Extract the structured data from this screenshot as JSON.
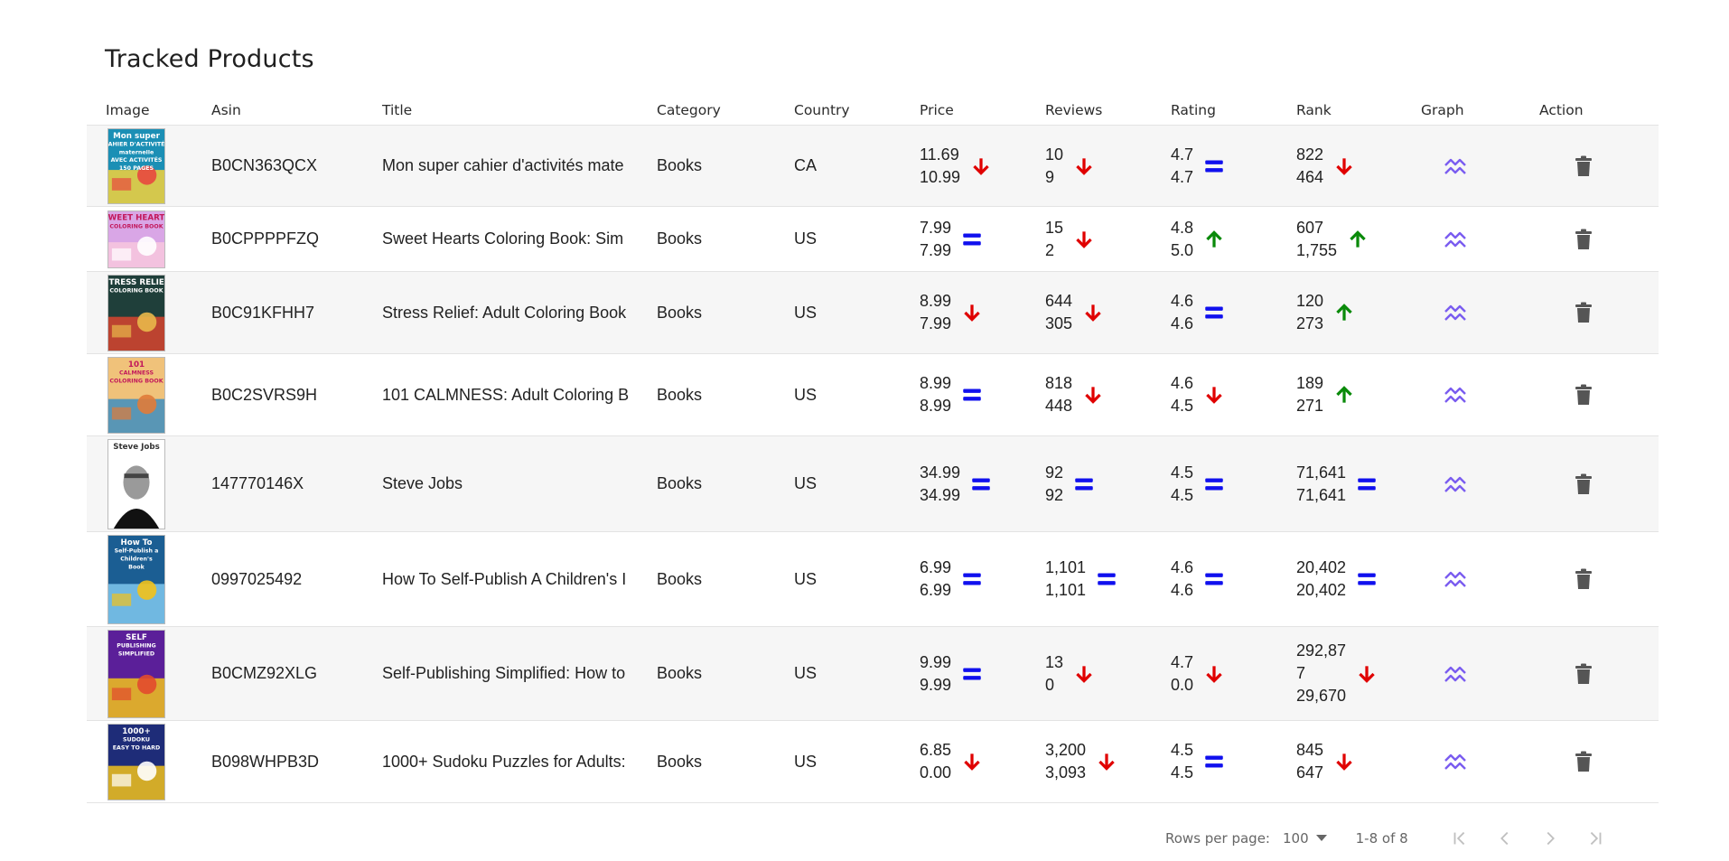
{
  "page": {
    "title": "Tracked Products"
  },
  "table": {
    "columns": [
      "Image",
      "Asin",
      "Title",
      "Category",
      "Country",
      "Price",
      "Reviews",
      "Rating",
      "Rank",
      "Graph",
      "Action"
    ],
    "rows": [
      {
        "asin": "B0CN363QCX",
        "title": "Mon super cahier d'activités mate",
        "category": "Books",
        "country": "CA",
        "price": [
          "11.69",
          "10.99"
        ],
        "price_trend": "down",
        "reviews": [
          "10",
          "9"
        ],
        "reviews_trend": "down",
        "rating": [
          "4.7",
          "4.7"
        ],
        "rating_trend": "equal",
        "rank": [
          "822",
          "464"
        ],
        "rank_trend": "down",
        "cover": {
          "colors": [
            "#1b8fb5",
            "#f4d23b",
            "#e8483f"
          ],
          "lines": [
            "Mon super",
            "CAHIER D'ACTIVITÉS",
            "maternelle",
            "AVEC ACTIVITÉS",
            "150 PAGES"
          ]
        }
      },
      {
        "asin": "B0CPPPPFZQ",
        "title": "Sweet Hearts Coloring Book: Sim",
        "category": "Books",
        "country": "US",
        "price": [
          "7.99",
          "7.99"
        ],
        "price_trend": "equal",
        "reviews": [
          "15",
          "2"
        ],
        "reviews_trend": "down",
        "rating": [
          "4.8",
          "5.0"
        ],
        "rating_trend": "up",
        "rank": [
          "607",
          "1,755"
        ],
        "rank_trend": "up",
        "cover": {
          "colors": [
            "#d9a6e6",
            "#f7c7dd",
            "#ffffff"
          ],
          "lines": [
            "SWEET HEARTS",
            "COLORING BOOK"
          ]
        }
      },
      {
        "asin": "B0C91KFHH7",
        "title": "Stress Relief: Adult Coloring Book",
        "category": "Books",
        "country": "US",
        "price": [
          "8.99",
          "7.99"
        ],
        "price_trend": "down",
        "reviews": [
          "644",
          "305"
        ],
        "reviews_trend": "down",
        "rating": [
          "4.6",
          "4.6"
        ],
        "rating_trend": "equal",
        "rank": [
          "120",
          "273"
        ],
        "rank_trend": "up",
        "cover": {
          "colors": [
            "#1f3f3a",
            "#d8442f",
            "#e8b84a"
          ],
          "lines": [
            "STRESS RELIEF",
            "COLORING BOOK"
          ]
        }
      },
      {
        "asin": "B0C2SVRS9H",
        "title": "101 CALMNESS: Adult Coloring B",
        "category": "Books",
        "country": "US",
        "price": [
          "8.99",
          "8.99"
        ],
        "price_trend": "equal",
        "reviews": [
          "818",
          "448"
        ],
        "reviews_trend": "down",
        "rating": [
          "4.6",
          "4.5"
        ],
        "rating_trend": "down",
        "rank": [
          "189",
          "271"
        ],
        "rank_trend": "up",
        "cover": {
          "colors": [
            "#f0c27a",
            "#3e8ec0",
            "#e07b39"
          ],
          "lines": [
            "101",
            "CALMNESS",
            "COLORING BOOK"
          ]
        }
      },
      {
        "asin": "147770146X",
        "title": "Steve Jobs",
        "category": "Books",
        "country": "US",
        "price": [
          "34.99",
          "34.99"
        ],
        "price_trend": "equal",
        "reviews": [
          "92",
          "92"
        ],
        "reviews_trend": "equal",
        "rating": [
          "4.5",
          "4.5"
        ],
        "rating_trend": "equal",
        "rank": [
          "71,641",
          "71,641"
        ],
        "rank_trend": "equal",
        "cover": {
          "colors": [
            "#ffffff",
            "#3a3a3a",
            "#111111"
          ],
          "lines": [
            "Steve Jobs"
          ]
        }
      },
      {
        "asin": "0997025492",
        "title": "How To Self-Publish A Children's I",
        "category": "Books",
        "country": "US",
        "price": [
          "6.99",
          "6.99"
        ],
        "price_trend": "equal",
        "reviews": [
          "1,101",
          "1,101"
        ],
        "reviews_trend": "equal",
        "rating": [
          "4.6",
          "4.6"
        ],
        "rating_trend": "equal",
        "rank": [
          "20,402",
          "20,402"
        ],
        "rank_trend": "equal",
        "cover": {
          "colors": [
            "#1b5e93",
            "#7fc8ee",
            "#f2c21b"
          ],
          "lines": [
            "How To",
            "Self-Publish a",
            "Children's",
            "Book"
          ]
        }
      },
      {
        "asin": "B0CMZ92XLG",
        "title": "Self-Publishing Simplified: How to",
        "category": "Books",
        "country": "US",
        "price": [
          "9.99",
          "9.99"
        ],
        "price_trend": "equal",
        "reviews": [
          "13",
          "0"
        ],
        "reviews_trend": "down",
        "rating": [
          "4.7",
          "0.0"
        ],
        "rating_trend": "down",
        "rank": [
          "292,87",
          "7",
          "29,670"
        ],
        "rank_trend": "down",
        "cover": {
          "colors": [
            "#5b1f99",
            "#f2c21b",
            "#e24a2e"
          ],
          "lines": [
            "SELF",
            "PUBLISHING",
            "SIMPLIFIED"
          ]
        }
      },
      {
        "asin": "B098WHPB3D",
        "title": "1000+ Sudoku Puzzles for Adults:",
        "category": "Books",
        "country": "US",
        "price": [
          "6.85",
          "0.00"
        ],
        "price_trend": "down",
        "reviews": [
          "3,200",
          "3,093"
        ],
        "reviews_trend": "down",
        "rating": [
          "4.5",
          "4.5"
        ],
        "rating_trend": "equal",
        "rank": [
          "845",
          "647"
        ],
        "rank_trend": "down",
        "cover": {
          "colors": [
            "#1e2c78",
            "#f2c21b",
            "#ffffff"
          ],
          "lines": [
            "1000+",
            "SUDOKU",
            "EASY TO HARD"
          ]
        }
      }
    ]
  },
  "icons": {
    "graph": "trend-chart-icon",
    "delete": "trash-icon",
    "up": "arrow-up-icon",
    "down": "arrow-down-icon",
    "equal": "equal-icon"
  },
  "colors": {
    "up": "#0a8a0a",
    "down": "#e00000",
    "equal": "#1010ee",
    "graph": "#7a5cf0",
    "delete": "#555555"
  },
  "pagination": {
    "rows_per_page_label": "Rows per page:",
    "rows_per_page_value": "100",
    "range": "1-8 of 8"
  }
}
